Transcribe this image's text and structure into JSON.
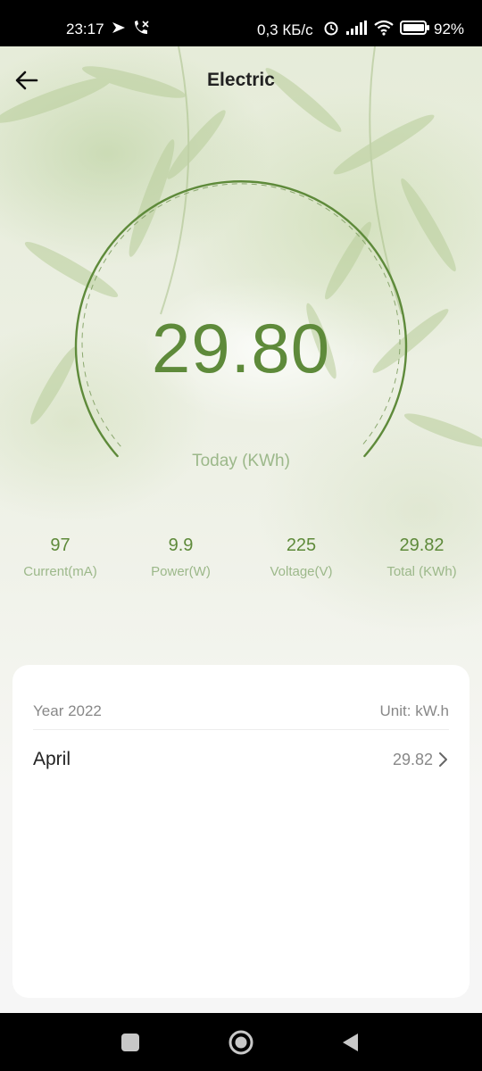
{
  "status_bar": {
    "time": "23:17",
    "network_speed": "0,3 КБ/с",
    "battery": "92%",
    "icons": [
      "location-icon",
      "call-icon",
      "alarm-icon",
      "signal-icon",
      "wifi-icon",
      "battery-icon"
    ]
  },
  "header": {
    "title": "Electric"
  },
  "gauge": {
    "value": "29.80",
    "caption": "Today (KWh)"
  },
  "stats": [
    {
      "value": "97",
      "label": "Current(mA)"
    },
    {
      "value": "9.9",
      "label": "Power(W)"
    },
    {
      "value": "225",
      "label": "Voltage(V)"
    },
    {
      "value": "29.82",
      "label": "Total (KWh)"
    }
  ],
  "history": {
    "year_label": "Year 2022",
    "unit_label": "Unit: kW.h",
    "rows": [
      {
        "month": "April",
        "value": "29.82"
      }
    ]
  },
  "colors": {
    "accent": "#5e8a3a",
    "accent_light": "#9cb88a"
  }
}
